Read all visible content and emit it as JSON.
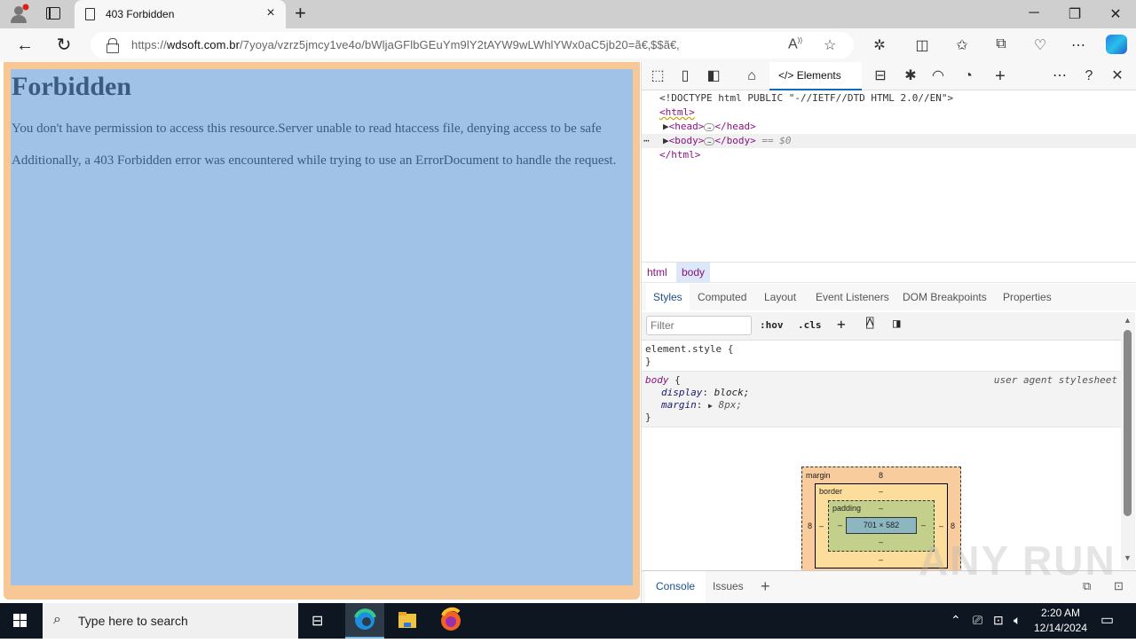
{
  "browser": {
    "tab_title": "403 Forbidden",
    "url_scheme": "https://",
    "url_host": "wdsoft.com.br",
    "url_path": "/7yoya/vzrz5jmcy1ve4o/bWljaGFlbGEuYm9lY2tAYW9wLWhlYWx0aC5jb20=ã€‚$$ã€‚",
    "icons": {
      "new_tab": "+",
      "close_tab": "×",
      "back": "←",
      "refresh": "↻",
      "minimize": "─",
      "restore": "❐",
      "close": "✕"
    }
  },
  "page": {
    "heading": "Forbidden",
    "paragraph1": "You don't have permission to access this resource.Server unable to read htaccess file, denying access to be safe",
    "paragraph2": "Additionally, a 403 Forbidden error was encountered while trying to use an ErrorDocument to handle the request.",
    "highlight_colors": {
      "margin": "#f7c796",
      "content": "#a0c2e7"
    }
  },
  "devtools": {
    "active_tab": "Elements",
    "dom": {
      "doctype": "<!DOCTYPE html PUBLIC \"-//IETF//DTD HTML 2.0//EN\">",
      "html_open": "<html>",
      "head_open": "<head>",
      "head_close": "</head>",
      "body_open": "<body>",
      "body_close": "</body>",
      "selected_marker": "== $0",
      "html_close": "</html>"
    },
    "breadcrumbs": [
      "html",
      "body"
    ],
    "subtabs": [
      "Styles",
      "Computed",
      "Layout",
      "Event Listeners",
      "DOM Breakpoints",
      "Properties"
    ],
    "filter_placeholder": "Filter",
    "hov_label": ":hov",
    "cls_label": ".cls",
    "styles": {
      "element_style_open": "element.style {",
      "close_brace": "}",
      "body_selector": "body",
      "open_brace": "{",
      "source": "user agent stylesheet",
      "props": [
        {
          "name": "display",
          "value": "block;"
        },
        {
          "name": "margin",
          "value": "8px;"
        }
      ]
    },
    "box_model": {
      "margin_label": "margin",
      "margin_top": "8",
      "margin_left": "8",
      "margin_right": "8",
      "border_label": "border",
      "border_value": "–",
      "padding_label": "padding",
      "padding_value": "–",
      "content_size": "701 × 582"
    },
    "drawer_tabs": [
      "Console",
      "Issues"
    ]
  },
  "taskbar": {
    "search_placeholder": "Type here to search",
    "time": "2:20 AM",
    "date": "12/14/2024"
  },
  "watermark": "ANY RUN"
}
